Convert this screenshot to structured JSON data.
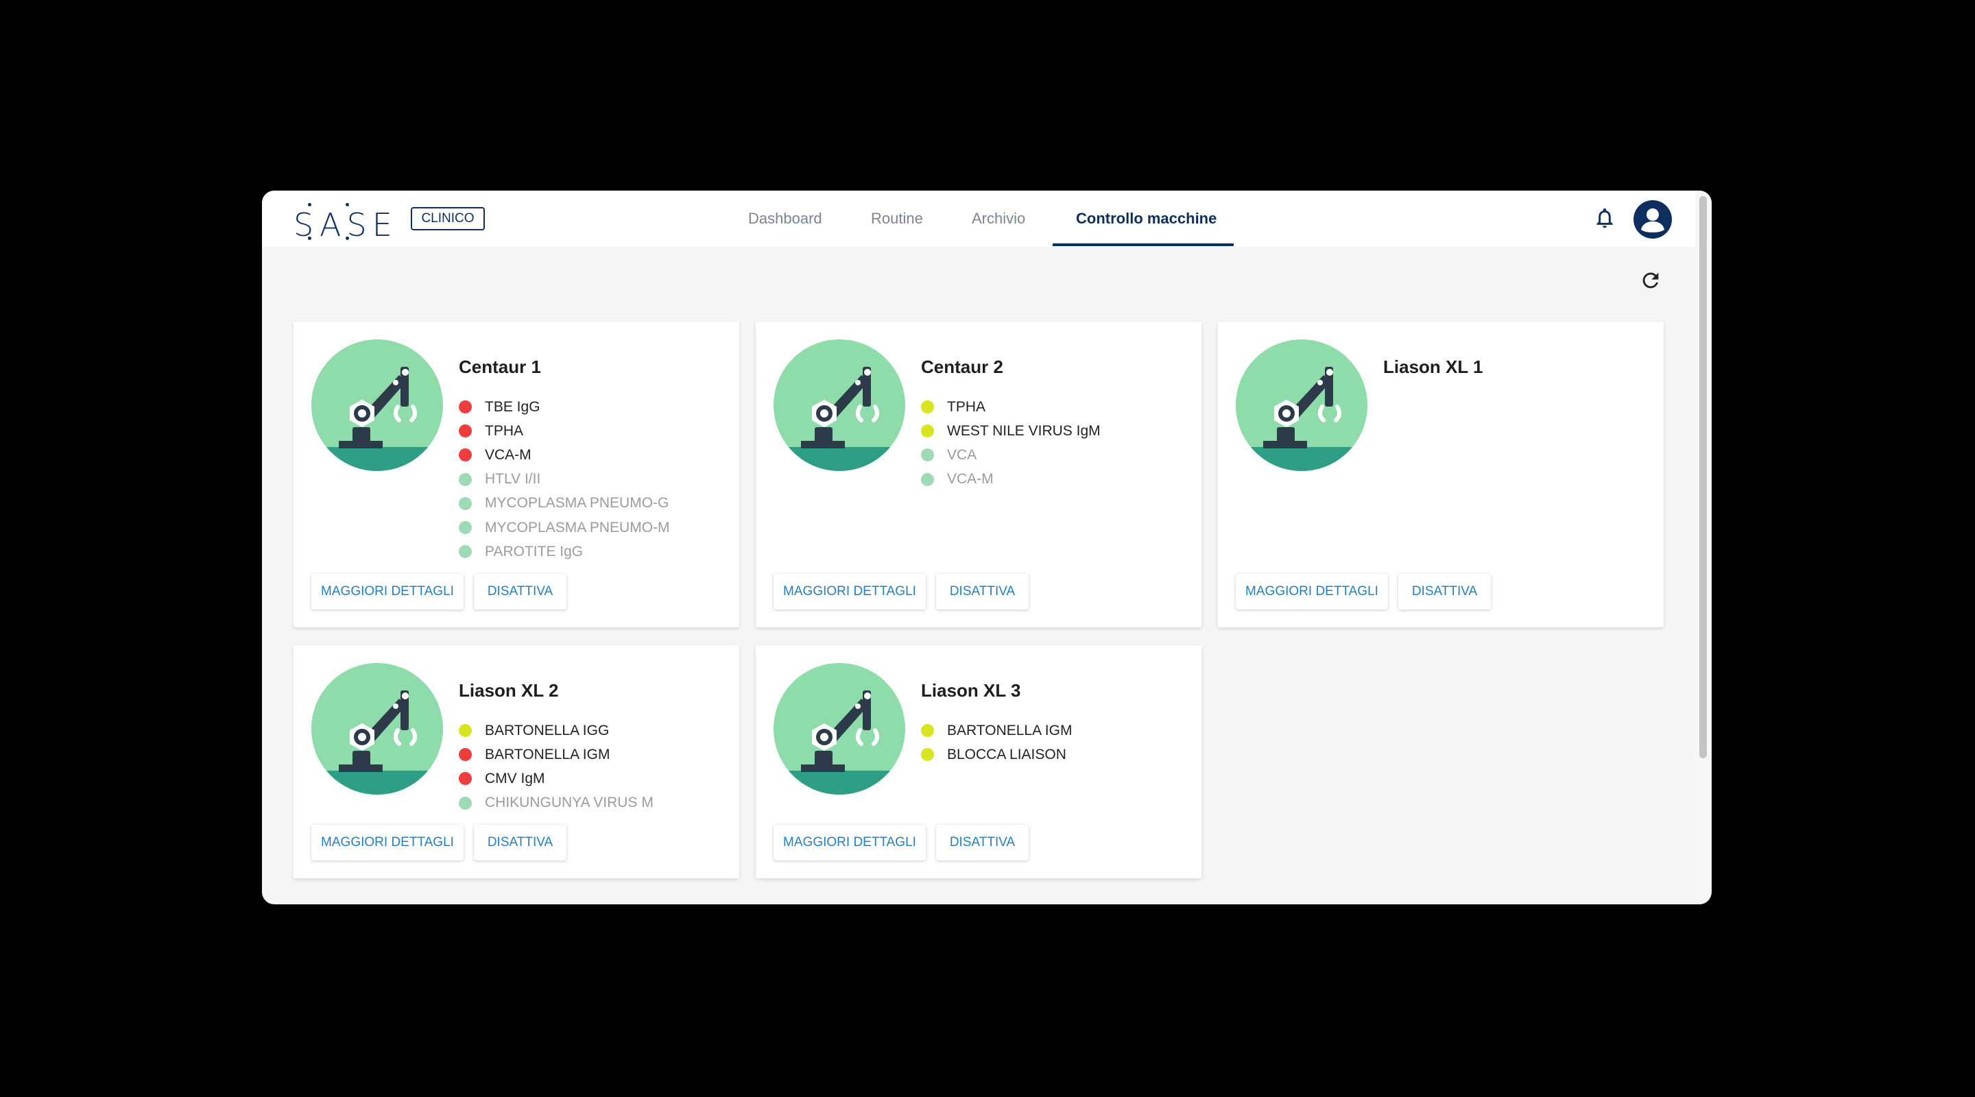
{
  "brand": {
    "logo_text": "SASE",
    "badge": "CLINICO"
  },
  "nav": {
    "tabs": [
      {
        "label": "Dashboard",
        "active": false
      },
      {
        "label": "Routine",
        "active": false
      },
      {
        "label": "Archivio",
        "active": false
      },
      {
        "label": "Controllo macchine",
        "active": true
      }
    ]
  },
  "icons": {
    "bell": "bell-icon",
    "avatar": "user-avatar-icon",
    "refresh": "refresh-icon",
    "machine": "robot-arm-icon"
  },
  "colors": {
    "primary": "#0d2f5f",
    "link": "#1f7fc2",
    "status_red": "#f03c3c",
    "status_yellow": "#d9e61f",
    "status_green": "#9edbb4",
    "machine_circle": "#8edcaa",
    "machine_ground": "#2e9f86"
  },
  "buttons": {
    "details": "MAGGIORI DETTAGLI",
    "deactivate": "DISATTIVA"
  },
  "machines": [
    {
      "name": "Centaur 1",
      "tests": [
        {
          "label": "TBE IgG",
          "status": "red"
        },
        {
          "label": "TPHA",
          "status": "red"
        },
        {
          "label": "VCA-M",
          "status": "red"
        },
        {
          "label": "HTLV I/II",
          "status": "green"
        },
        {
          "label": "MYCOPLASMA PNEUMO-G",
          "status": "green"
        },
        {
          "label": "MYCOPLASMA PNEUMO-M",
          "status": "green"
        },
        {
          "label": "PAROTITE IgG",
          "status": "green"
        }
      ]
    },
    {
      "name": "Centaur 2",
      "tests": [
        {
          "label": "TPHA",
          "status": "yellow"
        },
        {
          "label": "WEST NILE VIRUS IgM",
          "status": "yellow"
        },
        {
          "label": "VCA",
          "status": "green"
        },
        {
          "label": "VCA-M",
          "status": "green"
        }
      ]
    },
    {
      "name": "Liason XL 1",
      "tests": []
    },
    {
      "name": "Liason XL 2",
      "tests": [
        {
          "label": "BARTONELLA IGG",
          "status": "yellow"
        },
        {
          "label": "BARTONELLA IGM",
          "status": "red"
        },
        {
          "label": "CMV IgM",
          "status": "red"
        },
        {
          "label": "CHIKUNGUNYA VIRUS M",
          "status": "green"
        }
      ]
    },
    {
      "name": "Liason XL 3",
      "tests": [
        {
          "label": "BARTONELLA IGM",
          "status": "yellow"
        },
        {
          "label": "BLOCCA LIAISON",
          "status": "yellow"
        }
      ]
    }
  ]
}
